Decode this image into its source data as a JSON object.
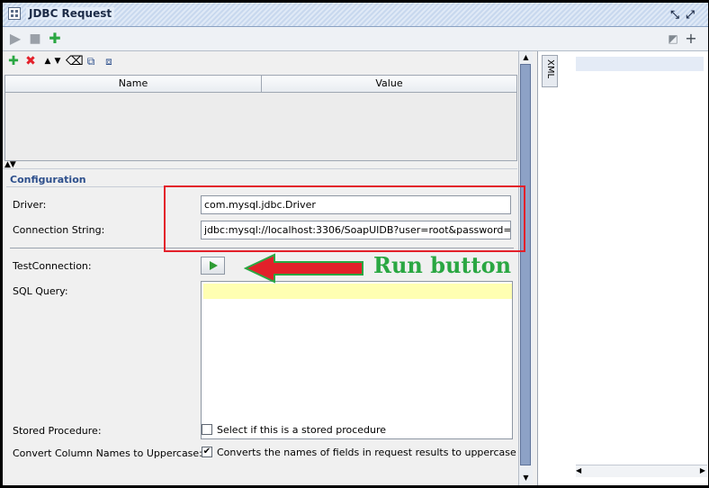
{
  "window": {
    "title": "JDBC Request"
  },
  "grid": {
    "columns": [
      "Name",
      "Value"
    ]
  },
  "config": {
    "title": "Configuration",
    "driver_label": "Driver:",
    "driver_value": "com.mysql.jdbc.Driver",
    "connection_label": "Connection String:",
    "connection_value": "jdbc:mysql://localhost:3306/SoapUIDB?user=root&password=",
    "test_connection_label": "TestConnection:",
    "sql_query_label": "SQL Query:",
    "stored_procedure_label": "Stored Procedure:",
    "stored_procedure_checkbox_label": "Select if this is a stored procedure",
    "stored_procedure_checked": false,
    "uppercase_label": "Convert Column Names to Uppercase:",
    "uppercase_checkbox_label": "Converts the names of fields in request results to uppercase",
    "uppercase_checked": true
  },
  "right_panel": {
    "tab": "XML"
  },
  "annotation": {
    "text": "Run button"
  },
  "colors": {
    "annotation_box": "#e3202a",
    "annotation_text": "#2aa742",
    "run_icon": "#2e9c34",
    "sql_highlight": "#ffffb2"
  },
  "icons": {
    "titlebar": [
      "window-icon",
      "restore-icon",
      "expand-icon"
    ],
    "toolbar": [
      "play-icon",
      "stop-icon",
      "add-icon",
      "clear-icon",
      "plus-icon"
    ],
    "subtoolbar": [
      "add-icon",
      "delete-icon",
      "move-up-icon",
      "move-down-icon",
      "eraser-icon",
      "copy-params-icon",
      "paste-params-icon"
    ]
  }
}
